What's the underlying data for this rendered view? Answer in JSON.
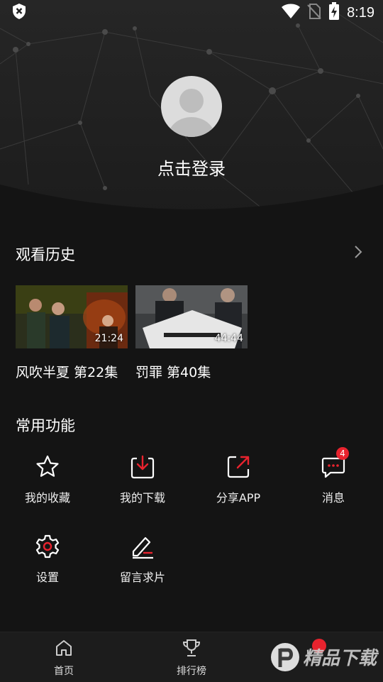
{
  "status_bar": {
    "time": "8:19",
    "icons": [
      "shield-x-icon",
      "wifi-icon",
      "no-sim-icon",
      "battery-charging-icon"
    ]
  },
  "profile": {
    "login_prompt": "点击登录",
    "avatar_icon": "default-avatar-icon"
  },
  "history": {
    "title": "观看历史",
    "more_icon": "chevron-right-icon",
    "items": [
      {
        "title": "风吹半夏 第22集",
        "duration": "21:24"
      },
      {
        "title": "罚罪 第40集",
        "duration": "44:44"
      }
    ]
  },
  "features": {
    "title": "常用功能",
    "items": [
      {
        "label": "我的收藏",
        "icon": "star-icon"
      },
      {
        "label": "我的下载",
        "icon": "download-icon"
      },
      {
        "label": "分享APP",
        "icon": "share-icon"
      },
      {
        "label": "消息",
        "icon": "message-icon",
        "badge": "4"
      },
      {
        "label": "设置",
        "icon": "gear-icon"
      },
      {
        "label": "留言求片",
        "icon": "edit-icon"
      }
    ]
  },
  "tabbar": {
    "items": [
      {
        "label": "首页",
        "icon": "home-icon"
      },
      {
        "label": "排行榜",
        "icon": "trophy-icon"
      }
    ]
  },
  "watermark": {
    "text": "精品下载"
  },
  "colors": {
    "background": "#141414",
    "accent": "#e8232e"
  }
}
